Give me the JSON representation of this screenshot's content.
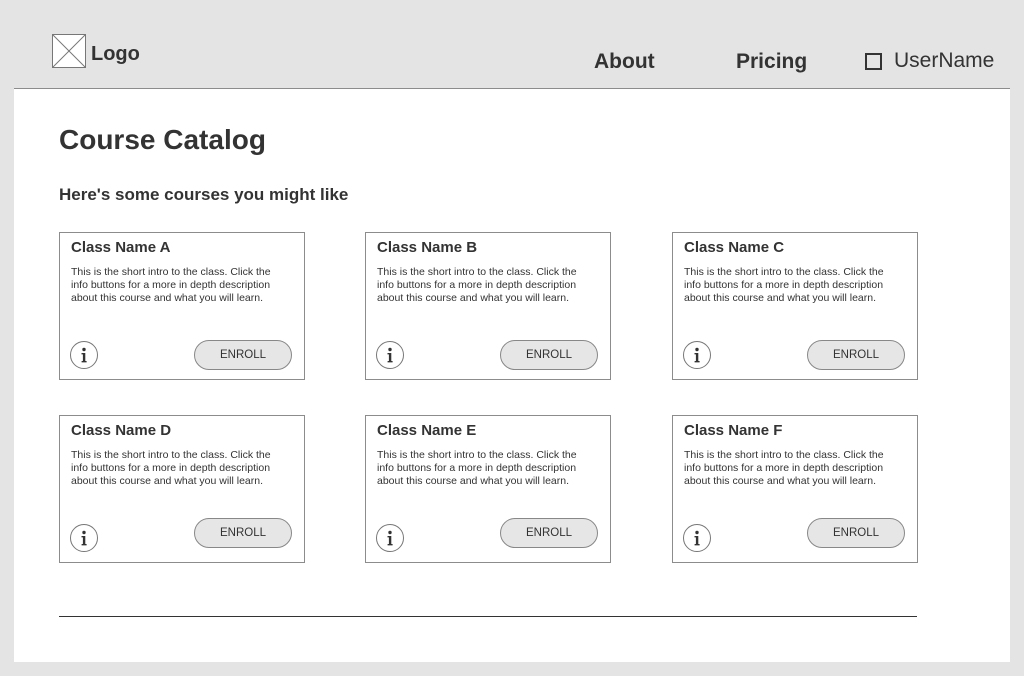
{
  "header": {
    "logo_text": "Logo",
    "logo_icon": "image-placeholder-icon",
    "nav": {
      "about": "About",
      "pricing": "Pricing"
    },
    "user": {
      "name": "UserName",
      "icon": "checkbox-icon"
    }
  },
  "main": {
    "title": "Course Catalog",
    "subtitle": "Here's some courses you might like",
    "courses": [
      {
        "name": "Class Name A",
        "description": "This is the short intro to the class. Click the info buttons for a more in depth description about this course and what you will learn.",
        "info_icon": "info-icon",
        "enroll_label": "ENROLL"
      },
      {
        "name": "Class Name B",
        "description": "This is the short intro to the class. Click the info buttons for a more in depth description about this course and what you will learn.",
        "info_icon": "info-icon",
        "enroll_label": "ENROLL"
      },
      {
        "name": "Class Name C",
        "description": "This is the short intro to the class. Click the info buttons for a more in depth description about this course and what you will learn.",
        "info_icon": "info-icon",
        "enroll_label": "ENROLL"
      },
      {
        "name": "Class Name D",
        "description": "This is the short intro to the class. Click the info buttons for a more in depth description about this course and what you will learn.",
        "info_icon": "info-icon",
        "enroll_label": "ENROLL"
      },
      {
        "name": "Class Name E",
        "description": "This is the short intro to the class. Click the info buttons for a more in depth description about this course and what you will learn.",
        "info_icon": "info-icon",
        "enroll_label": "ENROLL"
      },
      {
        "name": "Class Name F",
        "description": "This is the short intro to the class. Click the info buttons for a more in depth description about this course and what you will learn.",
        "info_icon": "info-icon",
        "enroll_label": "ENROLL"
      }
    ]
  },
  "colors": {
    "page_background": "#e4e4e4",
    "panel_background": "#ffffff",
    "text": "#333333",
    "border": "#8c8c8c",
    "button_fill": "#e6e6e6"
  }
}
